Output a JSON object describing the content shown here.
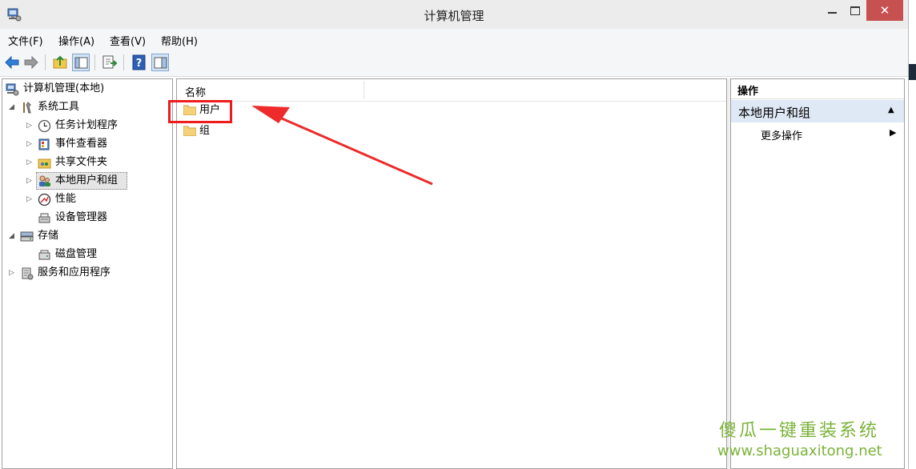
{
  "window": {
    "title": "计算机管理",
    "close_glyph": "✕"
  },
  "menu": [
    "文件(F)",
    "操作(A)",
    "查看(V)",
    "帮助(H)"
  ],
  "toolbar": {
    "buttons": [
      "back-arrow-icon",
      "forward-arrow-icon",
      "up-folder-icon",
      "show-tree-icon",
      "export-list-icon",
      "help-icon",
      "show-action-pane-icon"
    ]
  },
  "tree": {
    "root": "计算机管理(本地)",
    "system_tools": "系统工具",
    "task_scheduler": "任务计划程序",
    "event_viewer": "事件查看器",
    "shared_folders": "共享文件夹",
    "local_users": "本地用户和组",
    "performance": "性能",
    "device_manager": "设备管理器",
    "storage": "存储",
    "disk_management": "磁盘管理",
    "services": "服务和应用程序",
    "expanded_glyph": "◢",
    "collapsed_glyph": "▷"
  },
  "list": {
    "column_name": "名称",
    "items": [
      "用户",
      "组"
    ]
  },
  "actions": {
    "header": "操作",
    "section": "本地用户和组",
    "section_caret": "▲",
    "more": "更多操作",
    "more_arrow": "▶"
  },
  "watermark": {
    "cn": "傻瓜一键重装系统",
    "en": "www.shaguaxitong.net"
  },
  "colors": {
    "accent_red": "#ee1c1c",
    "close_button": "#c75050",
    "selected_section": "#dfe9f5",
    "watermark": "#7bb33a"
  }
}
